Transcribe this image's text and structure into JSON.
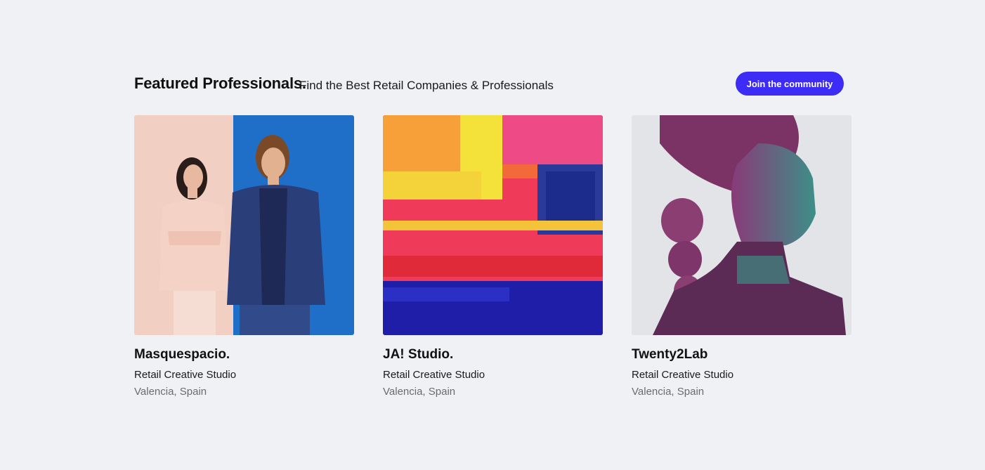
{
  "header": {
    "title": "Featured Professionals.",
    "subtitle": "Find the Best Retail Companies & Professionals",
    "join_label": "Join the community"
  },
  "colors": {
    "background": "#f0f1f4",
    "accent": "#3d2cf5"
  },
  "cards": [
    {
      "name": "Masquespacio.",
      "type": "Retail Creative Studio",
      "location": "Valencia, Spain",
      "image": "two-people-portrait"
    },
    {
      "name": "JA! Studio.",
      "type": "Retail Creative Studio",
      "location": "Valencia, Spain",
      "image": "abstract-paint"
    },
    {
      "name": "Twenty2Lab",
      "type": "Retail Creative Studio",
      "location": "Valencia, Spain",
      "image": "woman-profile-portrait"
    }
  ]
}
